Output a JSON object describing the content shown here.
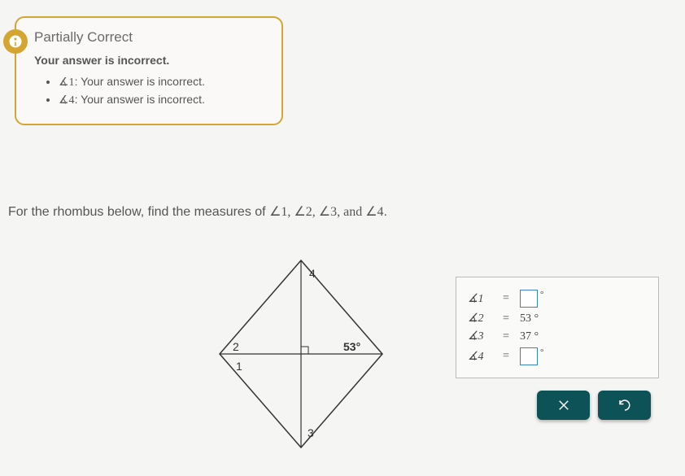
{
  "feedback": {
    "title": "Partially Correct",
    "subtitle": "Your answer is incorrect.",
    "items": [
      {
        "angle": "∡1",
        "text": ": Your answer is incorrect."
      },
      {
        "angle": "∡4",
        "text": ": Your answer is incorrect."
      }
    ]
  },
  "question": {
    "prefix": "For the rhombus below, find the measures of ",
    "angles": "∠1, ∠2, ∠3, and ∠4",
    "suffix": "."
  },
  "diagram": {
    "given_angle": "53°",
    "labels": {
      "l1": "1",
      "l2": "2",
      "l3": "3",
      "l4": "4"
    }
  },
  "answers": [
    {
      "label": "∡1",
      "value": "",
      "blank": true
    },
    {
      "label": "∡2",
      "value": "53 °",
      "blank": false
    },
    {
      "label": "∡3",
      "value": "37 °",
      "blank": false
    },
    {
      "label": "∡4",
      "value": "",
      "blank": true
    }
  ],
  "buttons": {
    "clear": "×",
    "reset": "↺"
  }
}
